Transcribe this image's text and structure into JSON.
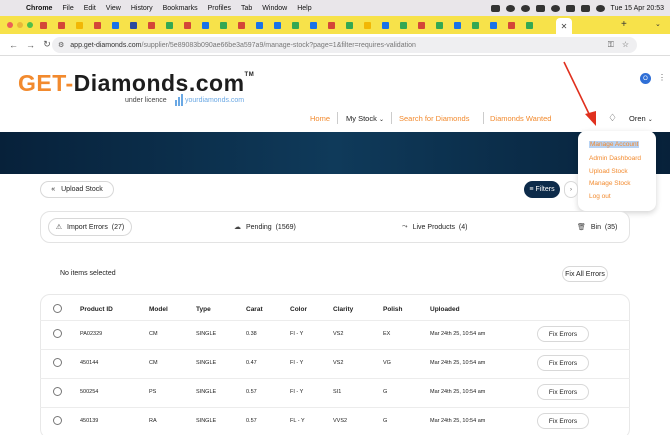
{
  "menubar": {
    "app": "Chrome",
    "items": [
      "File",
      "Edit",
      "View",
      "History",
      "Bookmarks",
      "Profiles",
      "Tab",
      "Window",
      "Help"
    ],
    "datetime": "Tue 15 Apr 20:53"
  },
  "browser": {
    "active_tab_close": "✕",
    "new_tab": "+",
    "url_host": "app.get-diamonds.com",
    "url_path": "/supplier/5e89083b090ae66be3a597a9/manage-stock?page=1&filter=requires-validation",
    "profile_initial": "O"
  },
  "header": {
    "logo_part1": "GET-",
    "logo_part2": "Diamonds.com",
    "logo_tm": "TM",
    "licence": "under licence",
    "licence_brand": "yourdiamonds.com",
    "nav": {
      "home": "Home",
      "my_stock": "My Stock",
      "search": "Search for Diamonds",
      "wanted": "Diamonds Wanted"
    },
    "user": "Oren"
  },
  "user_menu": {
    "items": [
      "Manage Account",
      "Admin Dashboard",
      "Upload Stock",
      "Manage Stock",
      "Log out"
    ],
    "selected": "Manage Account"
  },
  "toolbar": {
    "upload": "Upload Stock",
    "filters": "Filters"
  },
  "status_tabs": [
    {
      "label": "Import Errors",
      "count": "(27)"
    },
    {
      "label": "Pending",
      "count": "(1569)"
    },
    {
      "label": "Live Products",
      "count": "(4)"
    },
    {
      "label": "Bin",
      "count": "(35)"
    }
  ],
  "selection": {
    "status": "No items selected",
    "fix_all": "Fix All Errors"
  },
  "table": {
    "columns": [
      "Product ID",
      "Model",
      "Type",
      "Carat",
      "Color",
      "Clarity",
      "Polish",
      "Uploaded"
    ],
    "action_label": "Fix Errors",
    "rows": [
      [
        "PA02329",
        "CM",
        "SINGLE",
        "0.38",
        "FI - Y",
        "VS2",
        "EX",
        "Mar 24th 25, 10:54 am"
      ],
      [
        "450144",
        "CM",
        "SINGLE",
        "0.47",
        "FI - Y",
        "VS2",
        "VG",
        "Mar 24th 25, 10:54 am"
      ],
      [
        "500254",
        "PS",
        "SINGLE",
        "0.57",
        "FI - Y",
        "SI1",
        "G",
        "Mar 24th 25, 10:54 am"
      ],
      [
        "450139",
        "RA",
        "SINGLE",
        "0.57",
        "FL - Y",
        "VVS2",
        "G",
        "Mar 24th 25, 10:54 am"
      ]
    ]
  },
  "colors": {
    "brand_orange": "#f28a2e",
    "navy": "#0d2b4a",
    "tab_bar_yellow": "#f7e24a",
    "annotation_arrow": "#e0301e"
  }
}
